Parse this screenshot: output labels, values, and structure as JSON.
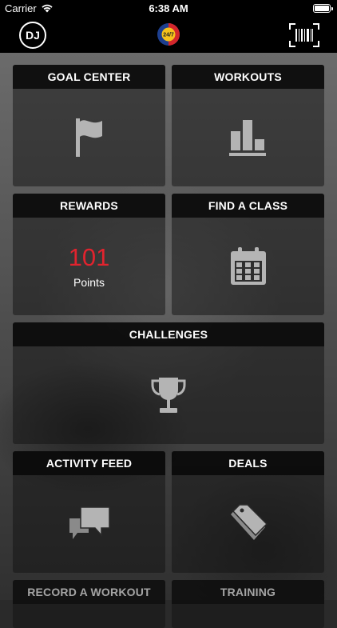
{
  "status_bar": {
    "carrier": "Carrier",
    "time": "6:38 AM"
  },
  "nav": {
    "avatar_initials": "DJ",
    "logo_text": "24/7"
  },
  "tiles": {
    "goal_center": {
      "title": "GOAL CENTER",
      "icon": "flag-icon"
    },
    "workouts": {
      "title": "WORKOUTS",
      "icon": "bar-chart-icon"
    },
    "rewards": {
      "title": "REWARDS",
      "points": "101",
      "points_label": "Points"
    },
    "find_a_class": {
      "title": "FIND A CLASS",
      "icon": "calendar-icon"
    },
    "challenges": {
      "title": "CHALLENGES",
      "icon": "trophy-icon"
    },
    "activity_feed": {
      "title": "ACTIVITY FEED",
      "icon": "chat-bubbles-icon"
    },
    "deals": {
      "title": "DEALS",
      "icon": "price-tags-icon"
    },
    "record_a_workout": {
      "title": "RECORD A WORKOUT"
    },
    "training": {
      "title": "TRAINING"
    }
  },
  "colors": {
    "accent_red": "#e1232e",
    "icon_gray": "#b4b4b4",
    "header_bg": "#080808"
  }
}
